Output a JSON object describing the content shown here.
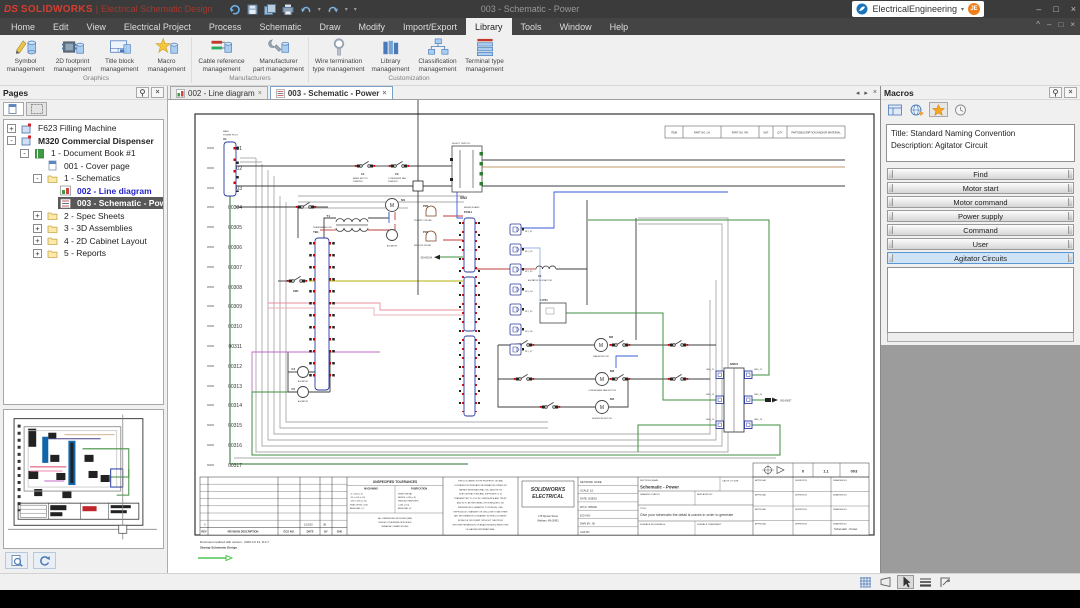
{
  "titlebar": {
    "brand_prefix": "DS",
    "brand": "SOLIDWORKS",
    "separator": "|",
    "app_name": "Electrical Schematic Design",
    "document_title": "003 - Schematic - Power",
    "account_name": "ElectricalEngineering",
    "avatar_initials": "JE"
  },
  "glyphs": {
    "dropdown": "▾",
    "minimize": "–",
    "maximize": "□",
    "close": "×",
    "collapse": "^",
    "tab_prev": "◂",
    "tab_next": "▸"
  },
  "menubar": {
    "items": [
      "Home",
      "Edit",
      "View",
      "Electrical Project",
      "Process",
      "Schematic",
      "Draw",
      "Modify",
      "Import/Export",
      "Library",
      "Tools",
      "Window",
      "Help"
    ],
    "active_item": "Library"
  },
  "ribbon": {
    "groups": [
      {
        "name": "Graphics",
        "buttons": [
          {
            "icon": "symbol-management-icon",
            "l1": "Symbol",
            "l2": "management"
          },
          {
            "icon": "footprint-management-icon",
            "l1": "2D footprint",
            "l2": "management"
          },
          {
            "icon": "title-block-management-icon",
            "l1": "Title block",
            "l2": "management"
          },
          {
            "icon": "macro-management-icon",
            "l1": "Macro",
            "l2": "management"
          }
        ]
      },
      {
        "name": "Manufacturers",
        "buttons": [
          {
            "icon": "cable-reference-management-icon",
            "l1": "Cable reference",
            "l2": "management"
          },
          {
            "icon": "manufacturer-part-management-icon",
            "l1": "Manufacturer",
            "l2": "part management"
          }
        ]
      },
      {
        "name": "Customization",
        "buttons": [
          {
            "icon": "wire-termination-type-icon",
            "l1": "Wire termination",
            "l2": "type management"
          },
          {
            "icon": "library-management-icon",
            "l1": "Library",
            "l2": "management"
          },
          {
            "icon": "classification-management-icon",
            "l1": "Classification",
            "l2": "management"
          },
          {
            "icon": "terminal-type-management-icon",
            "l1": "Terminal type",
            "l2": "management"
          }
        ]
      }
    ]
  },
  "pages_panel": {
    "title": "Pages",
    "items": [
      {
        "label": "F623 Filling Machine",
        "expand": "+"
      },
      {
        "label": "M320 Commercial Dispenser",
        "expand": "-"
      },
      {
        "label": "1 - Document Book #1",
        "expand": "-"
      },
      {
        "label": "001 - Cover page"
      },
      {
        "label": "1 - Schematics",
        "expand": "-"
      },
      {
        "label": "002 - Line diagram"
      },
      {
        "label": "003 - Schematic - Power"
      },
      {
        "label": "2 - Spec Sheets",
        "expand": "+"
      },
      {
        "label": "3 - 3D Assemblies",
        "expand": "+"
      },
      {
        "label": "4 - 2D Cabinet Layout",
        "expand": "+"
      },
      {
        "label": "5 - Reports",
        "expand": "+"
      }
    ]
  },
  "canvas_tabs": [
    {
      "label": "002 - Line diagram"
    },
    {
      "label": "003 - Schematic - Power"
    }
  ],
  "sheet": {
    "wire_numbers": [
      "00301",
      "00302",
      "00303",
      "00304",
      "00305",
      "00306",
      "00307",
      "00308",
      "00309",
      "00310",
      "00311",
      "00312",
      "00313",
      "00314",
      "00315",
      "00316",
      "00317"
    ],
    "item_table": [
      "ITEM",
      "PART NO. LH",
      "PART NO. RH",
      "SHT",
      "QTY",
      "PART/DESCRIPTION AND/OR MATERIAL"
    ],
    "d_labels": [
      "RLY_01",
      "RLY_02",
      "RLY_03",
      "RLY_04",
      "RLY_05",
      "RLY_06",
      "RLY_07"
    ],
    "gnd_pins": [
      "GND_11",
      "GND_12",
      "GND_13",
      "GND_14",
      "GND_15",
      "GND_16"
    ],
    "components": {
      "x1": "X1",
      "x1_desc1": "MAIN",
      "x1_desc2": "POWER PLUG",
      "tb1": "TB1",
      "tb1_desc": "TERMINAL BLOCK",
      "sw1": "SW1",
      "sw3": "SW3",
      "sw3_desc": "SELECT SWITCH",
      "c1": "C1",
      "c1_desc1": "BASIN MOTOR",
      "c1_desc2": "STARTER",
      "c2": "C2",
      "c2_desc1": "CONDENSER FAN",
      "c2_desc2": "STARTER",
      "c3": "C3",
      "c5": "C5",
      "agitator": "AGITATOR",
      "c4": "C4",
      "c4_desc": "AGITATOR CONTACTOR",
      "t1": "T1",
      "m": "M",
      "m1": "M1",
      "m2": "M2",
      "m3": "M3",
      "m4": "M4",
      "m2_desc": "BASIN MOTOR",
      "m3_desc": "CONDENSER FAN MOTOR",
      "m4_desc": "AGITATOR MOTOR",
      "pr1": "PR1",
      "pr1_desc": "MID LOW PROBE",
      "pr2": "PR2",
      "pr2_desc": "PRIORITY PROBE",
      "pcb1": "PCB1",
      "pcb1_desc": "RELAY BOARD",
      "fltb1": "F.LTB1",
      "gnd1": "GND1",
      "xref_left": "003-60014",
      "xref_right": "003-60007"
    },
    "titleblock": {
      "company_line1": "SOLIDWORKS",
      "company_line2": "ELECTRICAL",
      "address1": "175 Wyman Street",
      "address2": "Waltham, MA 02451",
      "network_node": "NETWORK NODE:",
      "scale": "SCALE:  1/1",
      "date": "DATE:  9/28/20",
      "wo": "WO #:  365209",
      "ecn": "ECN NO:",
      "dwn": "DWN BY:  JB",
      "chk": "CHK BY:",
      "file_label": "DEPT/FILE NAME:",
      "file_name": "Schematic - Power",
      "plot": "CAD PLOT SIZE",
      "status": "DRAWING STATUS:",
      "replaced": "REPLACED BY:",
      "title_label": "TITLE:",
      "title": "Give your schematic the detail is craves in order to generate",
      "rough": "SURFACE ROUGHNESS:",
      "treat": "SURFACE TREATMENT:",
      "approval": "APPROVAL",
      "definition": "DEFINITION",
      "drawing_no": "DRAWING NO.",
      "sheet_name": "Schematic - Power",
      "proj_cells": [
        "0",
        "1.1",
        "003"
      ]
    },
    "revision": {
      "headers": [
        "REV",
        "REVISION DESCRIPTION",
        "ECO NO.",
        "DATE",
        "BY",
        "CHK"
      ],
      "row": [
        "0",
        "1/15/20",
        "JB"
      ]
    },
    "tolerances": {
      "title": "UNSPECIFIED TOLERANCES",
      "col1": "MACHINING",
      "col2": "FABRICATION",
      "lines1": [
        ".X  ±.020  (±.5)",
        ".XX  ±.010  (±.25)",
        ".XXX ±.005 (±.13)",
        "FRACTIONS ±1/32",
        "ANGULAR  ±.5°"
      ],
      "lines2": [
        "SHEET METAL",
        "BENDS ±.030 (±.8)",
        "WELDED FEATURES",
        "±.060 (±1.5)",
        "ANGULAR  ±2°"
      ],
      "note": [
        "ALL DIMENSIONS IN INCHES (MM)",
        "UNLESS OTHERWISE SPECIFIED,",
        "BREAK ALL SHARP EDGES"
      ]
    },
    "legal_lines": [
      "THIS DOCUMENT IS THE PROPERTY OF, AND",
      "CONTAINS PROPRIETARY INFORMATION OWNED BY",
      "HAYNES INTERNATIONAL, INC. AND/OR ITS",
      "SUBCONTRACTORS AND SUPPLIERS. IT IS",
      "TRANSMITTED TO YOU IN CONFIDENCE AND TRUST,",
      "AND IS TO BE RETURNED UPON REQUEST. NO",
      "PERMISSION IS GRANTED TO PUBLISH, USE,",
      "REPRODUCE, TRANSMIT OR DISCLOSE TO ANOTHER",
      "ANY INFORMATION CONTAINED IN THIS DOCUMENT",
      "IN WHOLE OR IN PART, WITHOUT THE PRIOR",
      "WRITTEN PERMISSION OF AN AUTHORIZED EMPLOYEE",
      "OF HAYNES INTERNATIONAL."
    ],
    "footer_line1": "Document realized with version :  2020.0.0.13, R.0.7",
    "footer_line2": "Startup Schematic Design"
  },
  "macros_panel": {
    "title": "Macros",
    "info_title": "Title: Standard Naming Convention",
    "info_description": "Description: Agitator Circuit",
    "groups": [
      "Find",
      "Motor start",
      "Motor command",
      "Power supply",
      "Command",
      "User",
      "Agitator Circuits"
    ],
    "selected_group": "Agitator Circuits"
  },
  "colors": {
    "brand_red": "#d2232a",
    "accent_blue": "#2b3a9e",
    "selection_blue": "#cfe3f7",
    "wire_green": "#3f8f3f",
    "wire_blue": "#3a5bd9",
    "wire_red": "#c23b3b",
    "wire_tan": "#c49a6c",
    "wire_yellow": "#b5b000",
    "wire_magenta": "#c06ac0"
  }
}
